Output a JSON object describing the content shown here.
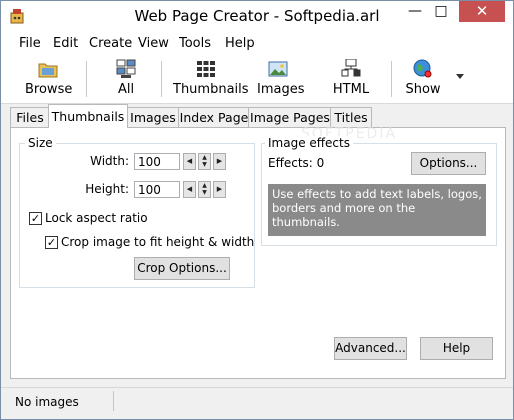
{
  "window": {
    "title": "Web Page Creator - Softpedia.arl"
  },
  "menu": [
    "File",
    "Edit",
    "Create",
    "View",
    "Tools",
    "Help"
  ],
  "toolbar": {
    "browse": "Browse",
    "all": "All",
    "thumbnails": "Thumbnails",
    "images": "Images",
    "html": "HTML",
    "show": "Show"
  },
  "tabs": [
    "Files",
    "Thumbnails",
    "Images",
    "Index Page",
    "Image Pages",
    "Titles"
  ],
  "active_tab": "Thumbnails",
  "size_group": {
    "title": "Size",
    "width_label": "Width:",
    "width_value": "100",
    "height_label": "Height:",
    "height_value": "100",
    "lock_aspect_label": "Lock aspect ratio",
    "lock_aspect_checked": true,
    "crop_label": "Crop image to fit height & width",
    "crop_checked": true,
    "crop_options_button": "Crop Options..."
  },
  "effects_group": {
    "title": "Image effects",
    "count_label": "Effects: 0",
    "options_button": "Options...",
    "description": "Use effects to add text labels, logos, borders and more on the thumbnails."
  },
  "buttons": {
    "advanced": "Advanced...",
    "help": "Help"
  },
  "status": {
    "text": "No images"
  },
  "watermark": "SOFTPEDIA"
}
